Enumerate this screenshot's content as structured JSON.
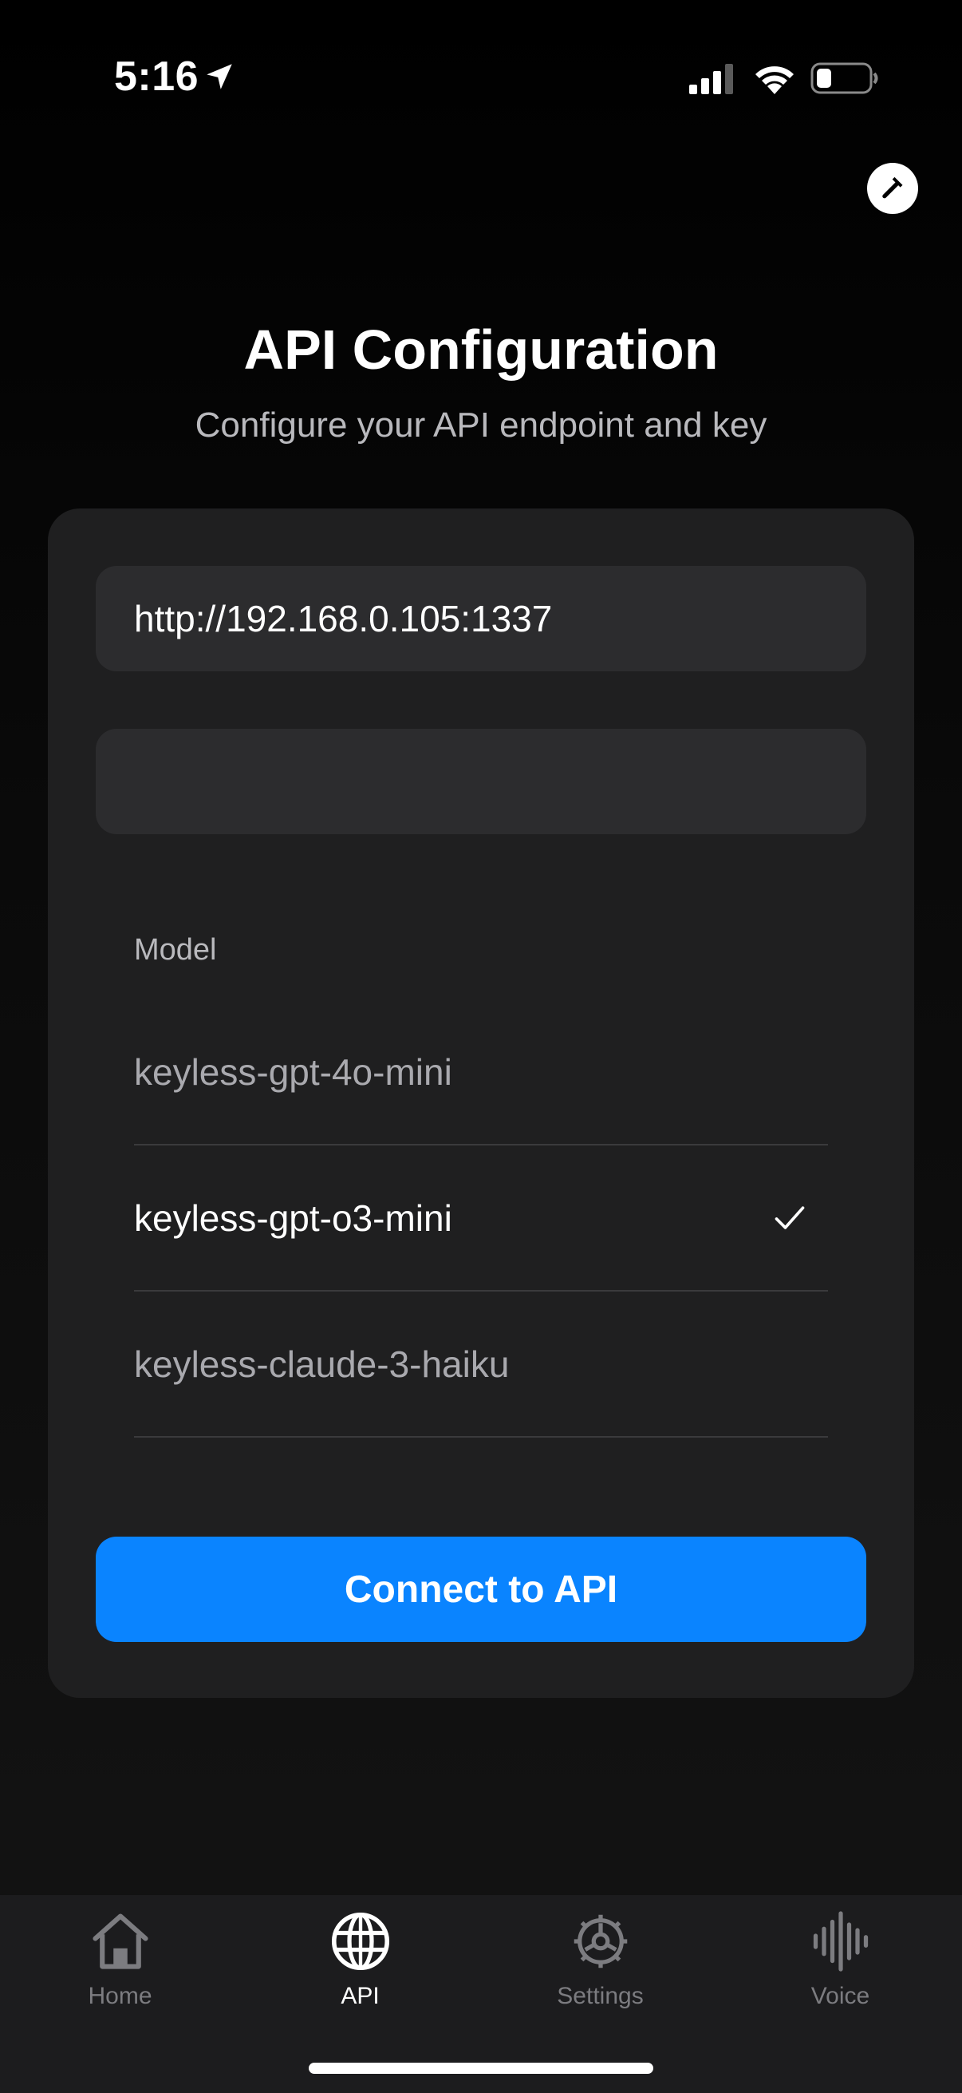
{
  "status_bar": {
    "time": "5:16",
    "icons": [
      "location-arrow-icon",
      "cellular-signal-icon",
      "wifi-icon",
      "battery-icon"
    ],
    "battery_level": 0.25
  },
  "toolbar": {
    "dev_button_icon": "hammer-icon"
  },
  "header": {
    "title": "API Configuration",
    "subtitle": "Configure your API endpoint and key"
  },
  "form": {
    "endpoint_value": "http://192.168.0.105:1337",
    "api_key_value": "",
    "model_label": "Model",
    "models": [
      {
        "name": "keyless-gpt-4o-mini",
        "selected": false
      },
      {
        "name": "keyless-gpt-o3-mini",
        "selected": true
      },
      {
        "name": "keyless-claude-3-haiku",
        "selected": false
      }
    ],
    "connect_label": "Connect to API"
  },
  "tabs": [
    {
      "label": "Home",
      "icon": "house-icon",
      "active": false
    },
    {
      "label": "API",
      "icon": "globe-icon",
      "active": true
    },
    {
      "label": "Settings",
      "icon": "gear-icon",
      "active": false
    },
    {
      "label": "Voice",
      "icon": "waveform-icon",
      "active": false
    }
  ],
  "colors": {
    "accent": "#0a84ff",
    "background": "#000000",
    "card": "#1f1f20",
    "field": "#2c2c2e"
  }
}
